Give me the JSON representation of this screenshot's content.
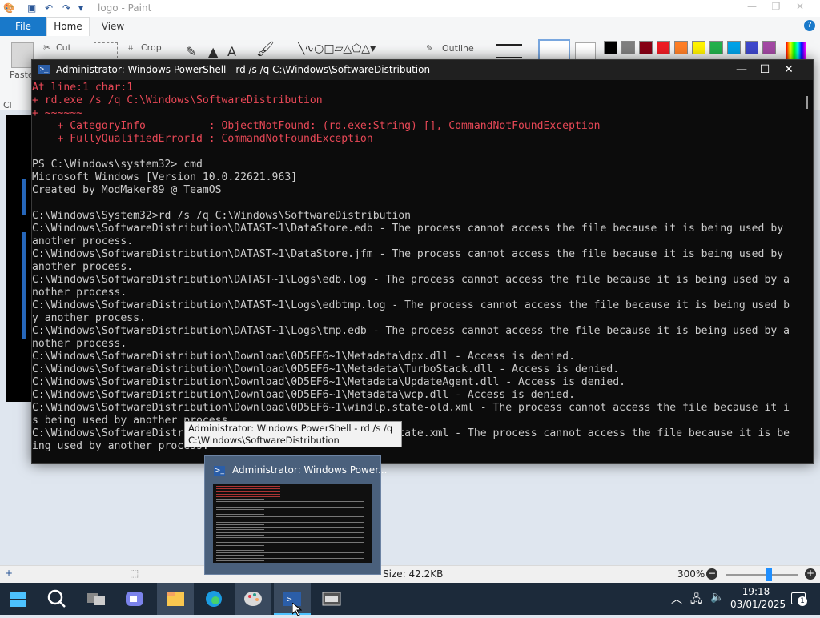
{
  "paint": {
    "title": "logo - Paint",
    "menu": {
      "file": "File",
      "home": "Home",
      "view": "View",
      "help": "?"
    },
    "ribbon": {
      "paste": "Paste",
      "clipboard": "Cl",
      "cut": "Cut",
      "crop": "Crop",
      "outline": "Outline"
    },
    "status": {
      "size": "Size: 42.2KB",
      "zoom": "300%",
      "zoom_level_percent": 300
    },
    "palette": [
      "#000000",
      "#7f7f7f",
      "#880015",
      "#ed1c24",
      "#ff7f27",
      "#fff200",
      "#22b14c",
      "#00a2e8",
      "#3f48cc",
      "#a349a4"
    ]
  },
  "powershell": {
    "title": "Administrator: Windows PowerShell - rd  /s /q C:\\Windows\\SoftwareDistribution",
    "controls": {
      "minimize": "—",
      "maximize": "☐",
      "close": "✕"
    },
    "lines": [
      {
        "text": "At line:1 char:1",
        "error": true
      },
      {
        "text": "+ rd.exe /s /q C:\\Windows\\SoftwareDistribution",
        "error": true
      },
      {
        "text": "+ ~~~~~~",
        "error": true
      },
      {
        "text": "    + CategoryInfo          : ObjectNotFound: (rd.exe:String) [], CommandNotFoundException",
        "error": true
      },
      {
        "text": "    + FullyQualifiedErrorId : CommandNotFoundException",
        "error": true
      },
      {
        "text": "",
        "error": false
      },
      {
        "text": "PS C:\\Windows\\system32> cmd",
        "error": false
      },
      {
        "text": "Microsoft Windows [Version 10.0.22621.963]",
        "error": false
      },
      {
        "text": "Created by ModMaker89 @ TeamOS",
        "error": false
      },
      {
        "text": "",
        "error": false
      },
      {
        "text": "C:\\Windows\\System32>rd /s /q C:\\Windows\\SoftwareDistribution",
        "error": false
      },
      {
        "text": "C:\\Windows\\SoftwareDistribution\\DATAST~1\\DataStore.edb - The process cannot access the file because it is being used by",
        "error": false
      },
      {
        "text": "another process.",
        "error": false
      },
      {
        "text": "C:\\Windows\\SoftwareDistribution\\DATAST~1\\DataStore.jfm - The process cannot access the file because it is being used by",
        "error": false
      },
      {
        "text": "another process.",
        "error": false
      },
      {
        "text": "C:\\Windows\\SoftwareDistribution\\DATAST~1\\Logs\\edb.log - The process cannot access the file because it is being used by a",
        "error": false
      },
      {
        "text": "nother process.",
        "error": false
      },
      {
        "text": "C:\\Windows\\SoftwareDistribution\\DATAST~1\\Logs\\edbtmp.log - The process cannot access the file because it is being used b",
        "error": false
      },
      {
        "text": "y another process.",
        "error": false
      },
      {
        "text": "C:\\Windows\\SoftwareDistribution\\DATAST~1\\Logs\\tmp.edb - The process cannot access the file because it is being used by a",
        "error": false
      },
      {
        "text": "nother process.",
        "error": false
      },
      {
        "text": "C:\\Windows\\SoftwareDistribution\\Download\\0D5EF6~1\\Metadata\\dpx.dll - Access is denied.",
        "error": false
      },
      {
        "text": "C:\\Windows\\SoftwareDistribution\\Download\\0D5EF6~1\\Metadata\\TurboStack.dll - Access is denied.",
        "error": false
      },
      {
        "text": "C:\\Windows\\SoftwareDistribution\\Download\\0D5EF6~1\\Metadata\\UpdateAgent.dll - Access is denied.",
        "error": false
      },
      {
        "text": "C:\\Windows\\SoftwareDistribution\\Download\\0D5EF6~1\\Metadata\\wcp.dll - Access is denied.",
        "error": false
      },
      {
        "text": "C:\\Windows\\SoftwareDistribution\\Download\\0D5EF6~1\\windlp.state-old.xml - The process cannot access the file because it i",
        "error": false
      },
      {
        "text": "s being used by another process.",
        "error": false
      },
      {
        "text": "C:\\Windows\\SoftwareDistribution\\Download\\0D5EF6~1\\windlp.state.xml - The process cannot access the file because it is be",
        "error": false
      },
      {
        "text": "ing used by another process.",
        "error": false
      }
    ]
  },
  "preview": {
    "tooltip": "Administrator: Windows PowerShell - rd  /s /q C:\\Windows\\SoftwareDistribution",
    "title": "Administrator: Windows Power..."
  },
  "taskbar": {
    "apps": [
      "start-icon",
      "search-icon",
      "task-view-icon",
      "chat-icon",
      "file-explorer-icon",
      "edge-icon",
      "paint-icon",
      "powershell-icon",
      "app-icon"
    ],
    "time": "19:18",
    "date": "03/01/2025",
    "notifications": "1"
  }
}
